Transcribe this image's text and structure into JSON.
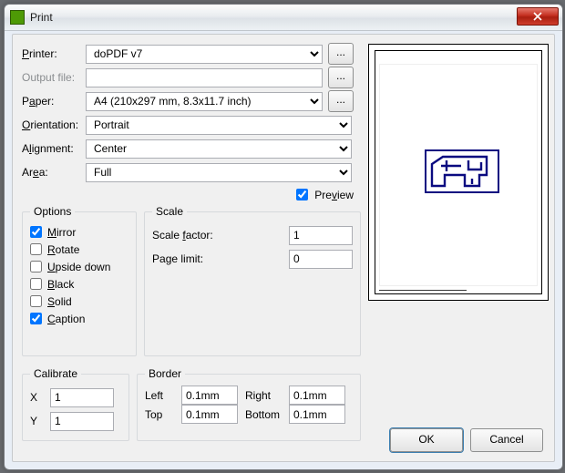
{
  "window": {
    "title": "Print"
  },
  "labels": {
    "printer": "Printer:",
    "output_file": "Output file:",
    "paper": "Paper:",
    "orientation": "Orientation:",
    "alignment": "Alignment:",
    "area": "Area:",
    "preview": "Preview",
    "options": "Options",
    "mirror": "Mirror",
    "rotate": "Rotate",
    "upside_down": "Upside down",
    "black": "Black",
    "solid": "Solid",
    "caption": "Caption",
    "scale": "Scale",
    "scale_factor": "Scale factor:",
    "page_limit": "Page limit:",
    "calibrate": "Calibrate",
    "x": "X",
    "y": "Y",
    "border": "Border",
    "left": "Left",
    "right": "Right",
    "top": "Top",
    "bottom": "Bottom",
    "ok": "OK",
    "cancel": "Cancel",
    "ellipsis": "..."
  },
  "values": {
    "printer": "doPDF v7",
    "output_file": "",
    "paper": "A4 (210x297 mm, 8.3x11.7 inch)",
    "orientation": "Portrait",
    "alignment": "Center",
    "area": "Full",
    "preview_checked": true,
    "mirror": true,
    "rotate": false,
    "upside_down": false,
    "black": false,
    "solid": false,
    "caption": true,
    "scale_factor": "1",
    "page_limit": "0",
    "cal_x": "1",
    "cal_y": "1",
    "border_left": "0.1mm",
    "border_right": "0.1mm",
    "border_top": "0.1mm",
    "border_bottom": "0.1mm"
  }
}
